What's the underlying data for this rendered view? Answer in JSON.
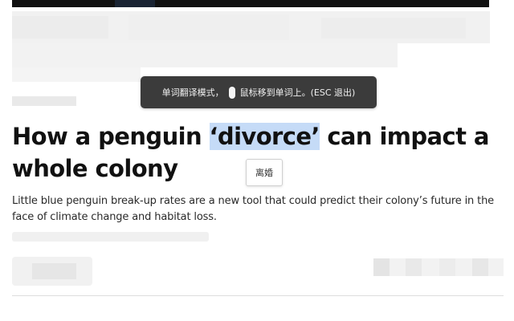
{
  "translate_banner": {
    "text_before": "单词翻译模式，",
    "text_after": "鼠标移到单词上。(ESC 退出)",
    "icon": "mouse-icon"
  },
  "article": {
    "headline_before": "How a penguin ",
    "headline_highlight": "‘divorce’",
    "headline_after": " can impact a whole colony",
    "summary": "Little blue penguin break-up rates are a new tool that could predict their colony’s future in the face of climate change and habitat loss."
  },
  "translation_popup": {
    "text": "离婚"
  },
  "colors": {
    "highlight": "#c5dbf7",
    "banner_bg": "#3b3b3b"
  }
}
